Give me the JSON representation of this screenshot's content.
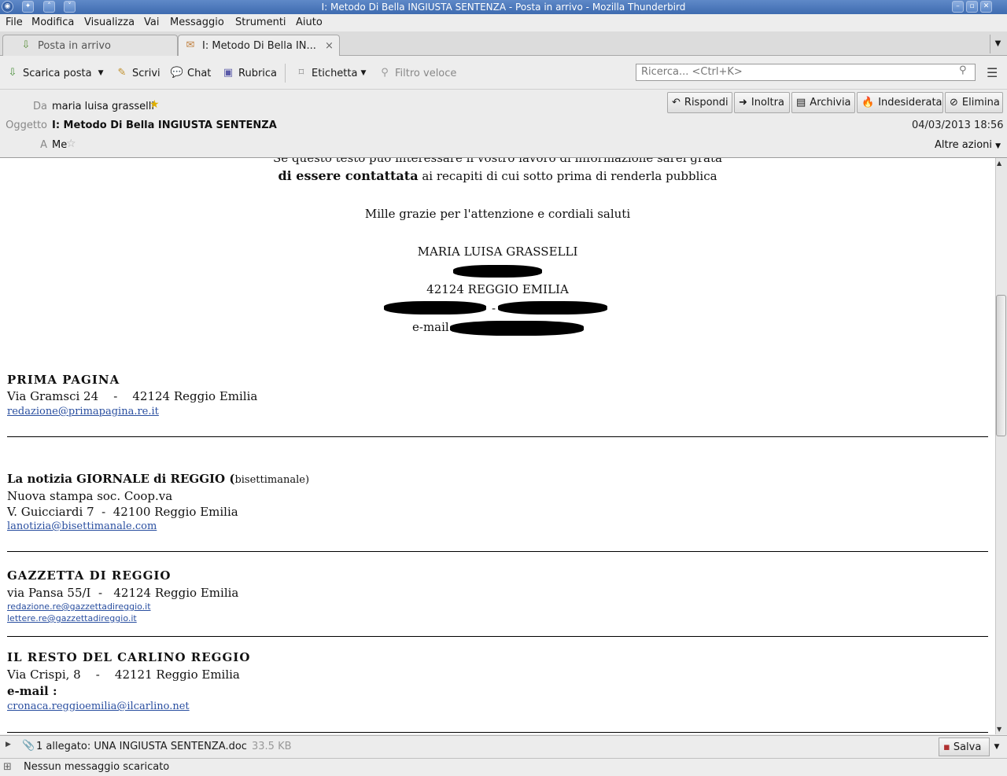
{
  "window": {
    "title": "I: Metodo Di Bella INGIUSTA SENTENZA - Posta in arrivo - Mozilla Thunderbird"
  },
  "menu": [
    "File",
    "Modifica",
    "Visualizza",
    "Vai",
    "Messaggio",
    "Strumenti",
    "Aiuto"
  ],
  "tabs": [
    {
      "label": "Posta in arrivo",
      "icon": "inbox-icon"
    },
    {
      "label": "I: Metodo Di Bella IN...",
      "icon": "envelope-icon",
      "close": "×"
    }
  ],
  "toolbar": {
    "get_mail": "Scarica posta",
    "write": "Scrivi",
    "chat": "Chat",
    "address_book": "Rubrica",
    "tag": "Etichetta",
    "quick_filter": "Filtro veloce",
    "search_placeholder": "Ricerca... <Ctrl+K>"
  },
  "header": {
    "from_label": "Da",
    "from": "maria luisa grasselli",
    "subject_label": "Oggetto",
    "subject": "I: Metodo Di Bella INGIUSTA SENTENZA",
    "to_label": "A",
    "to": "Me",
    "date": "04/03/2013 18:56",
    "more_actions": "Altre azioni",
    "actions": {
      "reply": "Rispondi",
      "forward": "Inoltra",
      "archive": "Archivia",
      "junk": "Indesiderata",
      "delete": "Elimina"
    }
  },
  "message": {
    "line_cut": "Se questo testo può interessare il vostro lavoro di informazione sarei grata",
    "contact_bold": "di essere contattata",
    "contact_rest": " ai recapiti di cui sotto prima di renderla pubblica",
    "thanks": "Mille grazie per l'attenzione e cordiali saluti",
    "signature_name": "MARIA LUISA GRASSELLI",
    "city": "42124 REGGIO EMILIA",
    "phone_sep": "-",
    "email_label": "e-mail",
    "contacts": [
      {
        "name": "PRIMA PAGINA",
        "address": "Via Gramsci 24    -    42124 Reggio Emilia",
        "emails": [
          "redazione@primapagina.re.it"
        ]
      },
      {
        "name": "La notizia GIORNALE di REGGIO (",
        "note": "bisettimanale)",
        "lines": [
          "Nuova stampa soc. Coop.va",
          "V. Guicciardi 7  -  42100 Reggio Emilia"
        ],
        "emails": [
          "lanotizia@bisettimanale.com"
        ]
      },
      {
        "name": "GAZZETTA DI REGGIO",
        "address": "via Pansa 55/I  -   42124 Reggio Emilia",
        "emails": [
          "redazione.re@gazzettadireggio.it",
          "lettere.re@gazzettadireggio.it"
        ]
      },
      {
        "name": "IL RESTO DEL CARLINO REGGIO",
        "address": "Via Crispi, 8    -    42121 Reggio Emilia",
        "email_label": "e-mail :",
        "emails": [
          "cronaca.reggioemilia@ilcarlino.net"
        ]
      }
    ]
  },
  "attachment": {
    "text": "1 allegato: UNA INGIUSTA SENTENZA.doc",
    "size": "33.5 KB",
    "save": "Salva"
  },
  "status": {
    "text": "Nessun messaggio scaricato"
  }
}
